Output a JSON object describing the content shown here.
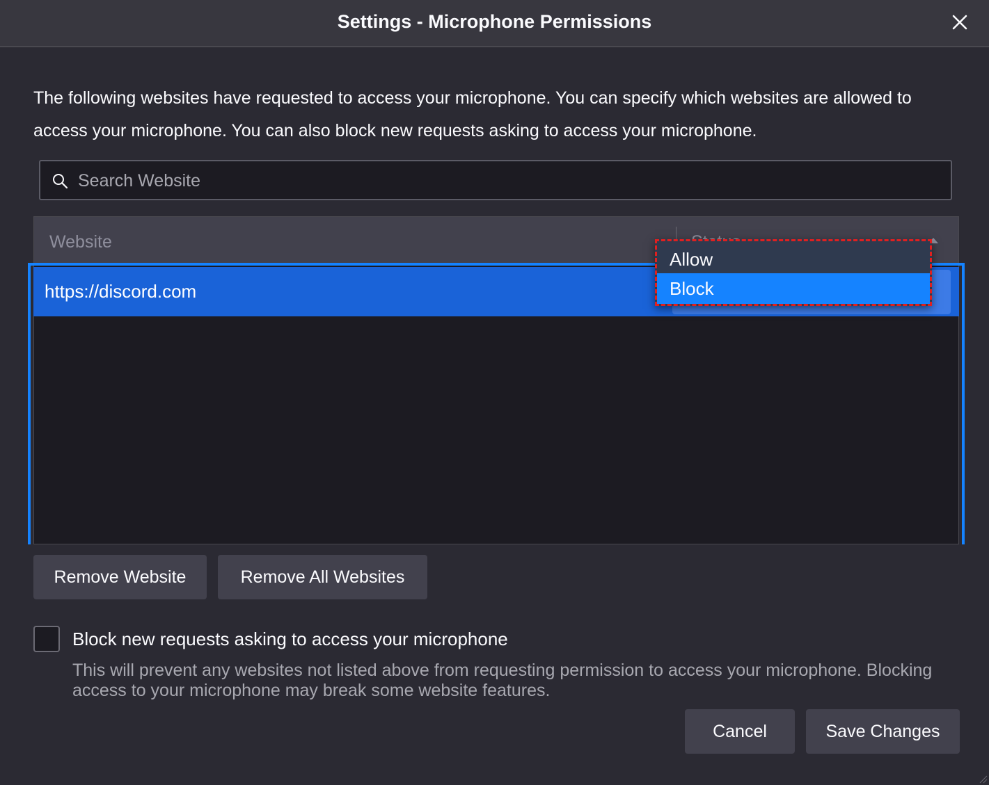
{
  "window": {
    "title": "Settings - Microphone Permissions"
  },
  "description": "The following websites have requested to access your microphone. You can specify which websites are allowed to access your microphone. You can also block new requests asking to access your microphone.",
  "search": {
    "placeholder": "Search Website",
    "value": ""
  },
  "table": {
    "columns": [
      "Website",
      "Status"
    ],
    "rows": [
      {
        "website": "https://discord.com",
        "status": "Block"
      }
    ]
  },
  "dropdown": {
    "options": [
      "Allow",
      "Block"
    ],
    "highlighted": "Block"
  },
  "buttons": {
    "remove_website": "Remove Website",
    "remove_all": "Remove All Websites",
    "cancel": "Cancel",
    "save": "Save Changes"
  },
  "block_new": {
    "checked": false,
    "label": "Block new requests asking to access your microphone",
    "description": "This will prevent any websites not listed above from requesting permission to access your microphone. Blocking access to your microphone may break some website features."
  },
  "colors": {
    "background": "#2b2a33",
    "selection": "#1a63d8",
    "accent": "#1583ff",
    "highlight_outline": "#e02020"
  },
  "icons": {
    "close": "close-icon",
    "search": "search-icon",
    "sort": "sort-ascending-icon",
    "grip": "resize-grip-icon"
  }
}
